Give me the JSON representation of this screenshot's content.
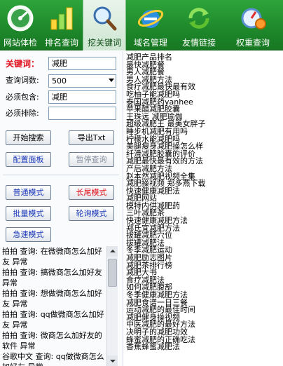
{
  "toolbar": {
    "items": [
      {
        "label": "网站体检",
        "icon": "gauge-icon"
      },
      {
        "label": "排名查询",
        "icon": "bar-chart-icon"
      },
      {
        "label": "挖关键词",
        "icon": "magnifier-icon"
      },
      {
        "label": "域名管理",
        "icon": "ie-globe-icon"
      },
      {
        "label": "友情链接",
        "icon": "refresh-arrows-icon"
      },
      {
        "label": "权重查询",
        "icon": "compass-gear-icon"
      }
    ],
    "active": 2,
    "accent": "#1f8a2c"
  },
  "form": {
    "keyword_label": "关键词：",
    "keyword_value": "减肥",
    "count_label": "查询词数:",
    "count_value": "500",
    "include_label": "必须包含:",
    "include_value": "减肥",
    "exclude_label": "必须排除:",
    "exclude_value": ""
  },
  "buttons": {
    "start": "开始搜索",
    "export": "导出Txt",
    "config": "配置面板",
    "pause": "暂停查询",
    "normal": "普通模式",
    "longtail": "长尾模式",
    "batch": "批量模式",
    "poll": "轮询模式",
    "fast": "急速模式"
  },
  "log": [
    "拍拍 查询: 在微微商怎么加好友 异常",
    "拍拍 查询: 搞微商怎么加好友 异常",
    "拍拍 查询: 想做微商怎么加好友 异常",
    "拍拍 查询: qq做微商怎么加好友 异常",
    "拍拍 查询: 微商怎么加好友的软件 异常",
    "谷歌中文 查询: qq做微商怎么加好友 异常"
  ],
  "results": [
    "减肥产品排名",
    "最快减肥餐",
    "男人减肥餐",
    "男人减肥方法",
    "食疗减肥最快最有效",
    "吃柚子能减肥吗",
    "泰国减肥药yanhee",
    "苹果醋减肥胶囊",
    "王珠远 减肥瑜伽",
    "超级减肥王 最美女胖子",
    "睡步机减肥有用吗",
    "柠檬水能减肥吗",
    "美腿瘦身减肥操怎么样",
    "纤滑减肥胶囊的评价",
    "减肥最快最有效的方法",
    "产后减肥方法",
    "赵本然减肥视频全集",
    "减肥操视频 郑多燕下载",
    "快速健康减肥法",
    "减肥网站",
    "模特内供减肥药",
    "三叶减肥茶",
    "快速健康减肥方法",
    "郑氏宜减肥方法",
    "拔罐减肥穴位",
    "拔罐减肥法",
    "冬季减肥运动",
    "减肥励志图片",
    "减肥茶排行榜",
    "减肥大书",
    "食疗减肥法",
    "如何减肥腹部",
    "冬季健康减肥方法",
    "减肥食谱一日三餐",
    "运动减肥的最佳时间",
    "减肥健身操视频",
    "中医减肥的最好方法",
    "决明子的减肥功效",
    "蜂蜜减肥的正确吃法",
    "香蕉蜂蜜减肥法"
  ]
}
